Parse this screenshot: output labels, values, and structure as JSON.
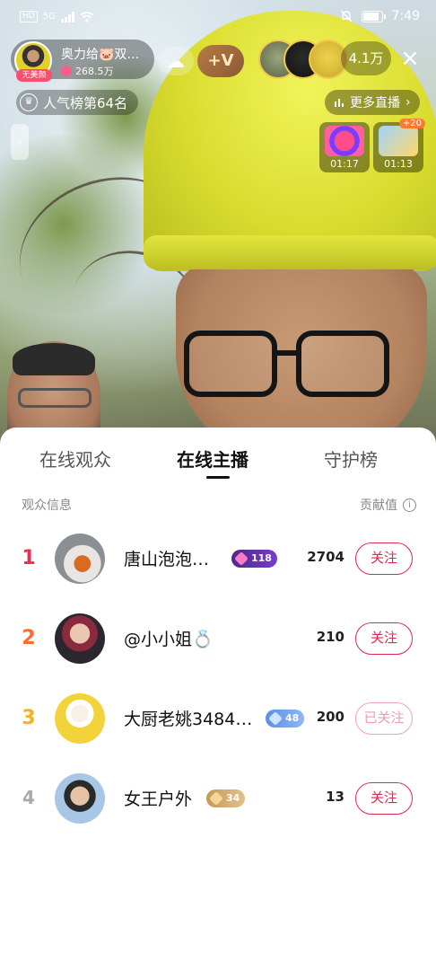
{
  "status_bar": {
    "left_labels": [
      "HD",
      "5G"
    ],
    "time": "7:49",
    "icons": [
      "signal-icon",
      "wifi-icon",
      "mute-icon",
      "battery-icon"
    ]
  },
  "anchor": {
    "name": "奥力给🐷双…",
    "likes": "268.5万",
    "no_beauty_tag": "无美颜",
    "follow_badge": "+V",
    "cloud_icon": "cloud-icon"
  },
  "audience": {
    "count": "4.1万",
    "close_label": "×"
  },
  "popularity": {
    "label": "人气榜第64名"
  },
  "more_live": {
    "label": "更多直播",
    "chevron": "›"
  },
  "task_cards": [
    {
      "timer": "01:17",
      "icon": "gift-box-icon"
    },
    {
      "timer": "01:13",
      "icon": "treasure-icon",
      "plus": "+20"
    }
  ],
  "tabs": [
    {
      "label": "在线观众",
      "active": false
    },
    {
      "label": "在线主播",
      "active": true
    },
    {
      "label": "守护榜",
      "active": false
    }
  ],
  "list_header": {
    "left": "观众信息",
    "right": "贡献值",
    "info_icon": "i"
  },
  "rows": [
    {
      "rank": "1",
      "name": "唐山泡泡…",
      "badge": "118",
      "score": "2704",
      "follow": "关注",
      "followed": false
    },
    {
      "rank": "2",
      "name": "@小小姐💍",
      "badge": "",
      "score": "210",
      "follow": "关注",
      "followed": false
    },
    {
      "rank": "3",
      "name": "大厨老姚3484…",
      "badge": "48",
      "score": "200",
      "follow": "已关注",
      "followed": true
    },
    {
      "rank": "4",
      "name": "女王户外",
      "badge": "34",
      "score": "13",
      "follow": "关注",
      "followed": false
    }
  ],
  "colors": {
    "accent": "#e0284d",
    "rank1": "#ef2d4f",
    "rank2": "#ff6b2c",
    "rank3": "#f7b21a",
    "rank4": "#aaaaaa"
  }
}
